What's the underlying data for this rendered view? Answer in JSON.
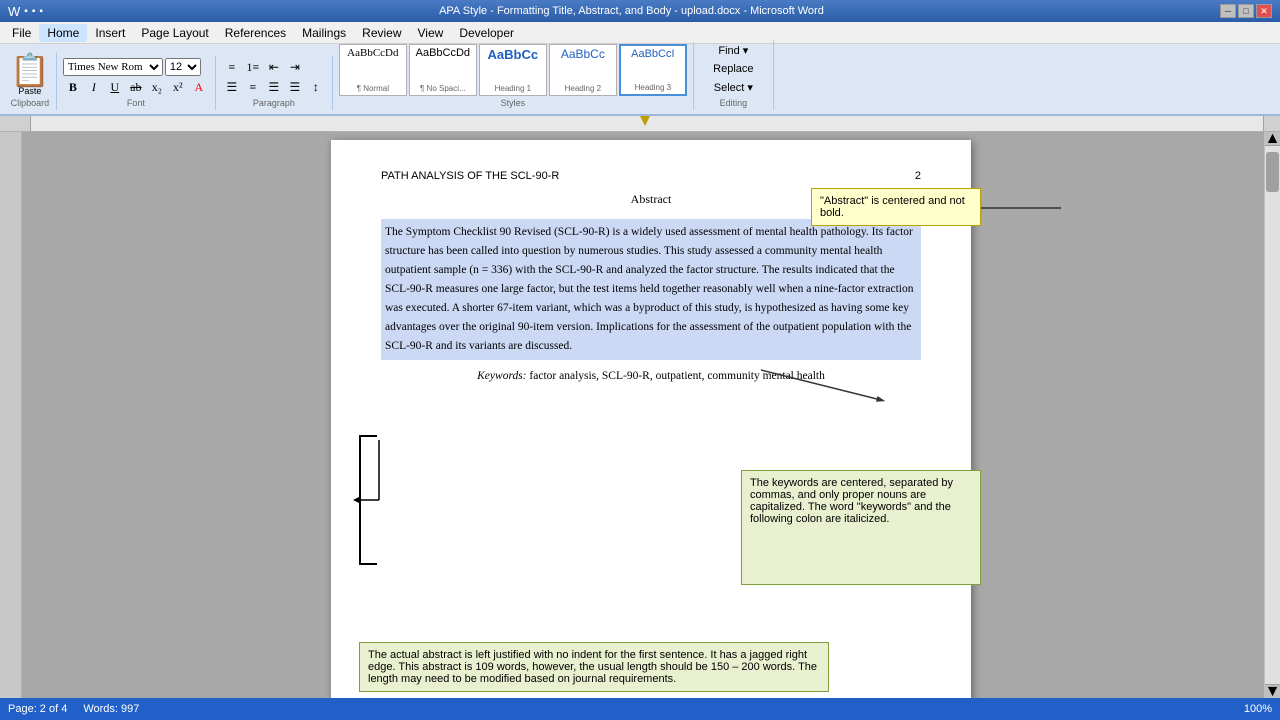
{
  "titleBar": {
    "title": "APA Style - Formatting Title, Abstract, and Body - upload.docx - Microsoft Word",
    "minimize": "─",
    "maximize": "□",
    "close": "✕"
  },
  "menuBar": {
    "items": [
      "File",
      "Home",
      "Insert",
      "Page Layout",
      "References",
      "Mailings",
      "Review",
      "View",
      "Developer"
    ]
  },
  "ribbon": {
    "activeTab": "Home",
    "clipboard": {
      "label": "Clipboard",
      "paste": "📋"
    },
    "font": {
      "label": "Font",
      "fontName": "Times New Rom",
      "fontSize": "12",
      "bold": "B",
      "italic": "I",
      "underline": "U"
    },
    "paragraph": {
      "label": "Paragraph"
    },
    "styles": {
      "label": "Styles",
      "items": [
        {
          "preview": "AaBbCcDd",
          "label": "¶ Normal",
          "selected": true
        },
        {
          "preview": "AaBbCcDd",
          "label": "¶ No Spaci..."
        },
        {
          "preview": "AaBbCc",
          "label": "Heading 1"
        },
        {
          "preview": "AaBbCc",
          "label": "Heading 2"
        },
        {
          "preview": "AaBbCcI",
          "label": "Heading 3"
        }
      ]
    },
    "editing": {
      "label": "Editing",
      "find": "Find ▾",
      "replace": "Replace",
      "select": "Select ▾"
    }
  },
  "document": {
    "runningHead": "PATH ANALYSIS OF THE SCL-90-R",
    "pageNumber": "2",
    "abstractTitle": "Abstract",
    "abstractBody": "The Symptom Checklist 90 Revised (SCL-90-R) is a widely used assessment of mental health pathology. Its factor structure has been called into question by numerous studies. This study assessed a community mental health outpatient sample (n = 336) with the SCL-90-R and analyzed the factor structure. The results indicated that the SCL-90-R measures one large factor, but the test items held together reasonably well when a nine-factor extraction was executed. A shorter 67-item variant, which was a byproduct of this study, is hypothesized as having some key advantages over the original 90-item version. Implications for the assessment of the outpatient population with the SCL-90-R and its variants are discussed.",
    "keywords": {
      "label": "Keywords:",
      "text": "factor analysis, SCL-90-R, outpatient, community mental health"
    }
  },
  "annotations": {
    "abstract": "\"Abstract\" is centered and not bold.",
    "keywords": "The keywords are centered, separated by commas, and only proper nouns are capitalized. The word \"keywords\" and the following colon are italicized.",
    "bottom": "The actual abstract is left justified with no indent for the first sentence. It has a jagged right edge. This abstract is 109 words, however, the usual length should be 150 – 200 words. The length may need to be modified based on journal requirements."
  },
  "statusBar": {
    "page": "Page: 2 of 4",
    "words": "Words: 997",
    "zoom": "100%"
  }
}
